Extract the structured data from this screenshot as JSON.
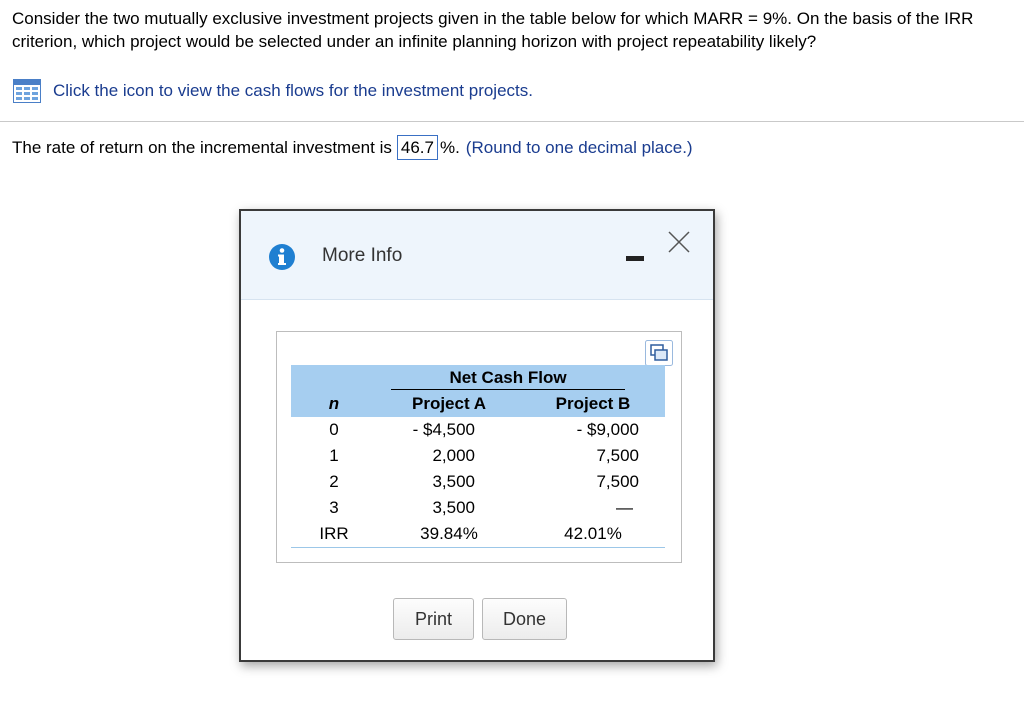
{
  "question": {
    "text": "Consider the two mutually exclusive investment projects given in the table below for which MARR = 9%. On the basis of the IRR criterion, which project would be selected under an infinite planning horizon with project repeatability likely?"
  },
  "help_link": {
    "icon": "table-icon",
    "text": "Click the icon to view the cash flows for the investment projects."
  },
  "answer": {
    "prefix": "The rate of return on the incremental investment is",
    "value": "46.7",
    "suffix": "%.",
    "hint": "(Round to one decimal place.)"
  },
  "modal": {
    "title": "More Info",
    "icons": {
      "info": "info-icon",
      "minimize": "minimize-icon",
      "close": "close-icon",
      "copy": "copy-icon"
    },
    "table": {
      "group_header": "Net Cash Flow",
      "columns": [
        "n",
        "Project A",
        "Project B"
      ],
      "rows": [
        [
          "0",
          "- $4,500",
          "- $9,000"
        ],
        [
          "1",
          "2,000",
          "7,500"
        ],
        [
          "2",
          "3,500",
          "7,500"
        ],
        [
          "3",
          "3,500",
          "—"
        ]
      ],
      "irr_row": [
        "IRR",
        "39.84%",
        "42.01%"
      ]
    },
    "buttons": {
      "print": "Print",
      "done": "Done"
    }
  },
  "colors": {
    "link": "#1a3c8f",
    "table_header_bg": "#a6cef0",
    "modal_header_bg": "#eef5fc",
    "info_icon": "#1f7fd1",
    "answer_border": "#3a70c4"
  }
}
